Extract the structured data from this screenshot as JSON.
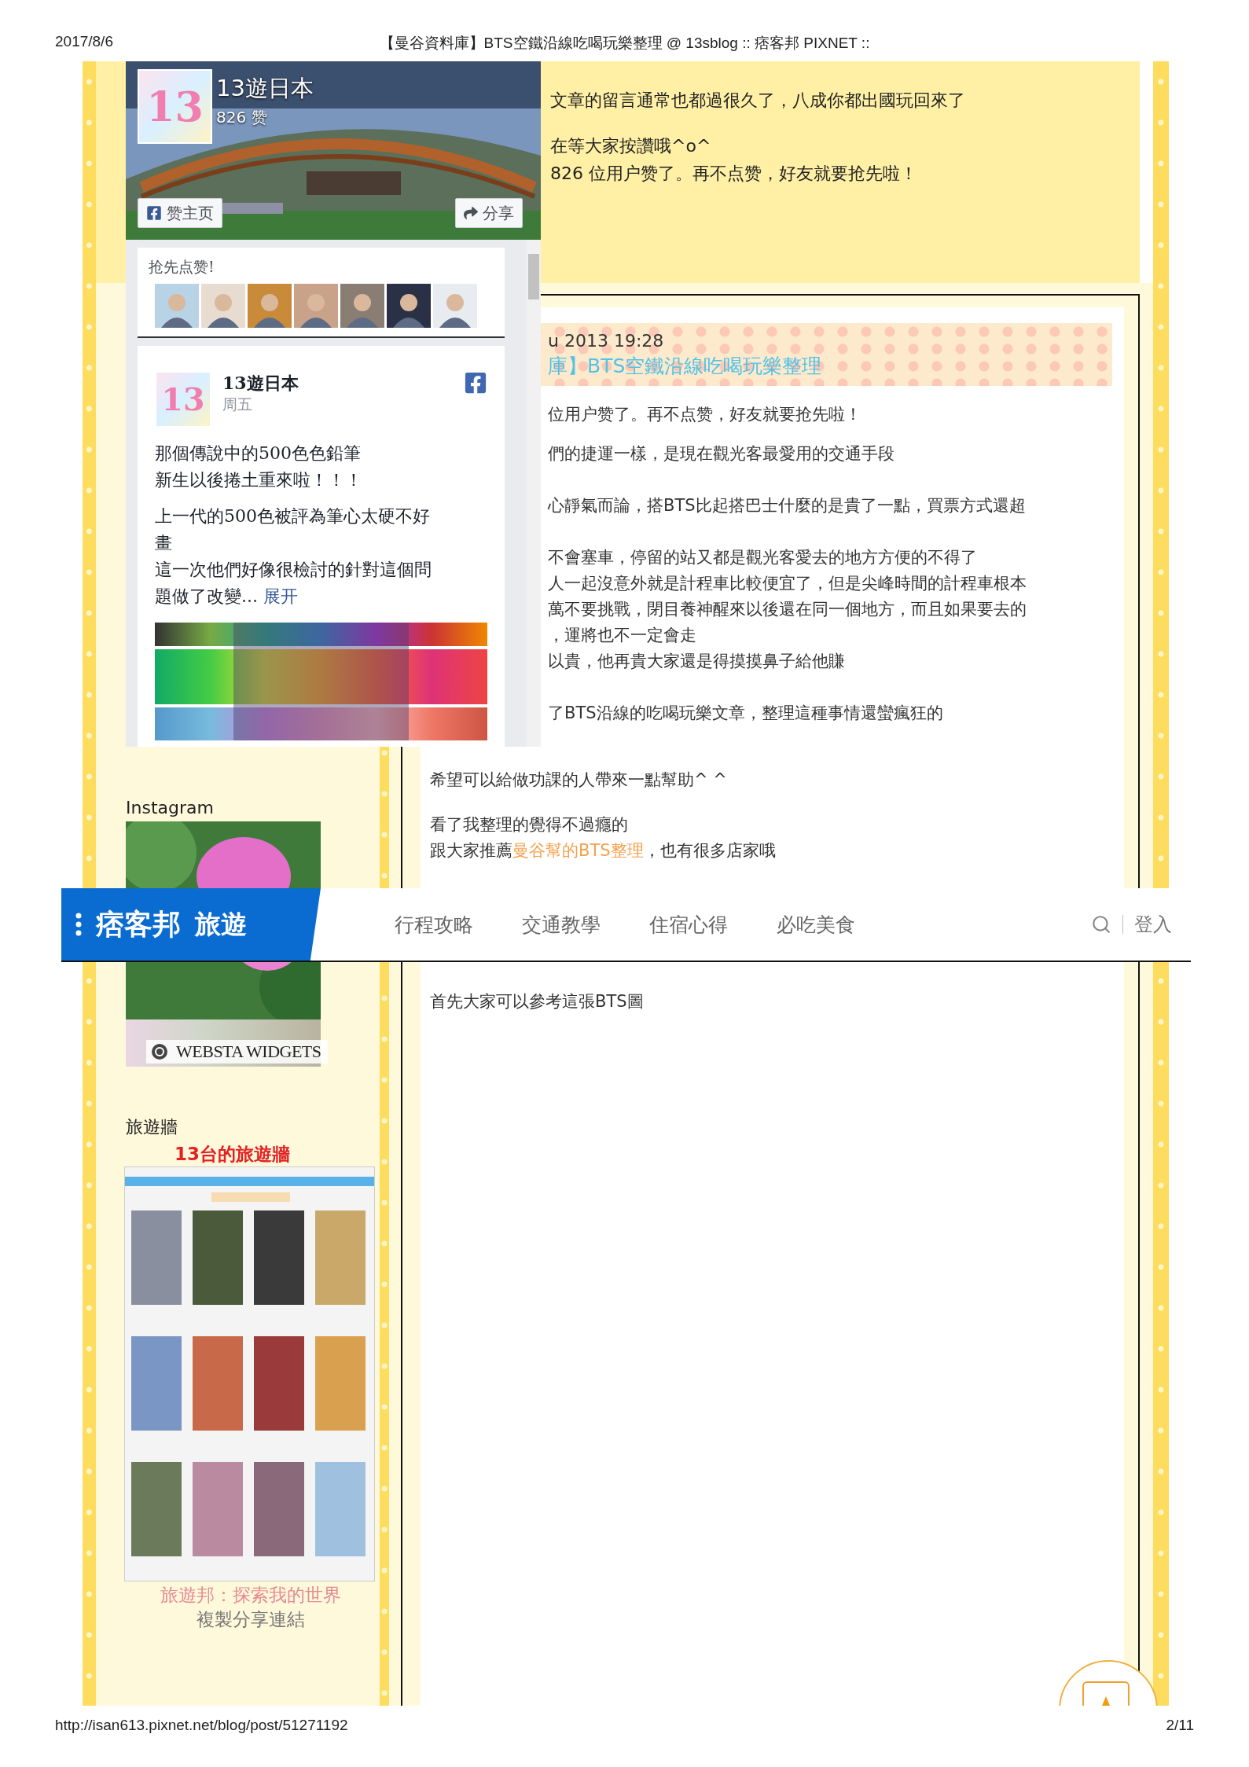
{
  "header": {
    "date": "2017/8/6",
    "title": "【曼谷資料庫】BTS空鐵沿線吃喝玩樂整理 @ 13sblog :: 痞客邦 PIXNET ::"
  },
  "comment_box": {
    "paragraphs": [
      [
        "文章的留言通常也都過很久了，八成你都出國玩回來了"
      ],
      [
        "在等大家按讚哦^o^",
        "826 位用户赞了。再不点赞，好友就要抢先啦！"
      ]
    ]
  },
  "facebook_widget": {
    "logo_text": "13",
    "page_name": "13遊日本",
    "likes": "826 赞",
    "like_button": "赞主页",
    "share_button": "分享",
    "friends_title": "抢先点赞!",
    "friend_avatars": [
      {
        "kind": "picture"
      },
      {
        "kind": "picture"
      },
      {
        "kind": "picture"
      },
      {
        "kind": "picture"
      },
      {
        "kind": "picture"
      },
      {
        "kind": "picture"
      },
      {
        "kind": "picture"
      }
    ],
    "post": {
      "logo_text": "13",
      "author": "13遊日本",
      "day": "周五",
      "paragraphs": [
        [
          "那個傳說中的500色色鉛筆",
          "新生以後捲土重來啦！！！"
        ],
        [
          "上一代的500色被評為筆心太硬不好",
          "畫",
          "這一次他們好像很檢討的針對這個問",
          "題做了改變..."
        ]
      ],
      "expand_link": "展开",
      "image": {
        "kind": "picture"
      }
    }
  },
  "post_header": {
    "date": "u 2013 19:28",
    "title": "庫】BTS空鐵沿線吃喝玩樂整理"
  },
  "clipped_paragraphs": [
    [
      "位用户赞了。再不点赞，好友就要抢先啦！"
    ],
    [
      "們的捷運一樣，是現在觀光客最愛用的交通手段"
    ],
    [
      "心靜氣而論，搭BTS比起搭巴士什麼的是貴了一點，買票方式還超"
    ],
    [
      "不會塞車，停留的站又都是觀光客愛去的地方方便的不得了",
      "人一起沒意外就是計程車比較便宜了，但是尖峰時間的計程車根本",
      "萬不要挑戰，閉目養神醒來以後還在同一個地方，而且如果要去的",
      "，運將也不一定會走",
      "以貴，他再貴大家還是得摸摸鼻子給他賺"
    ],
    [
      "了BTS沿線的吃喝玩樂文章，整理這種事情還蠻瘋狂的"
    ]
  ],
  "paragraphs": [
    [
      [
        {
          "text": "希望可以給做功課的人帶來一點幫助^ ^",
          "link": false
        }
      ]
    ],
    [
      [
        {
          "text": "看了我整理的覺得不過癮的",
          "link": false
        }
      ],
      [
        {
          "text": "跟大家推薦",
          "link": false
        },
        {
          "text": "曼谷幫的BTS整理",
          "link": true
        },
        {
          "text": "，也有很多店家哦",
          "link": false
        }
      ]
    ]
  ],
  "after_nav_text": "首先大家可以參考這張BTS圖",
  "sidebar": {
    "instagram": {
      "title": "Instagram",
      "badge": "WEBSTA WIDGETS"
    },
    "travel_wall": {
      "title": "旅遊牆",
      "subtitle": "13台的旅遊牆",
      "tagline": "旅遊邦：探索我的世界",
      "share_link": "複製分享連結"
    }
  },
  "nav_bar": {
    "brand": "痞客邦",
    "section": "旅遊",
    "items": [
      {
        "label": "行程攻略"
      },
      {
        "label": "交通教學"
      },
      {
        "label": "住宿心得"
      },
      {
        "label": "必吃美食"
      }
    ],
    "login": "登入"
  },
  "footer": {
    "url": "http://isan613.pixnet.net/blog/post/51271192",
    "page": "2/11"
  }
}
